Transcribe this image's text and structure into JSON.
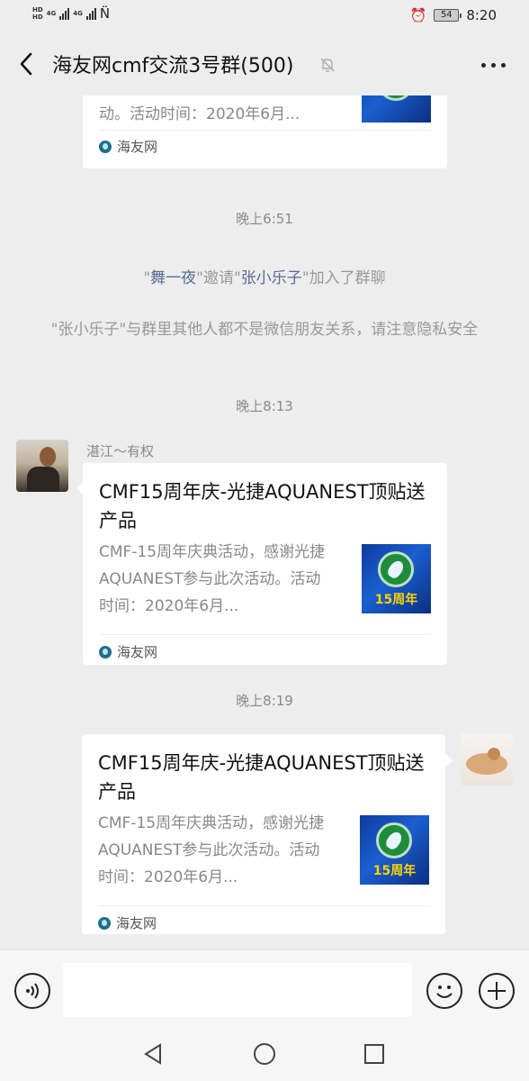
{
  "status_bar": {
    "network_label": "4G",
    "network_label_2": "4G",
    "carrier_speed": "",
    "battery": "54",
    "time": "8:20"
  },
  "header": {
    "title": "海友网cmf交流3号群(500)",
    "icons": [
      "back-icon",
      "mute-icon",
      "more-icon"
    ]
  },
  "messages": {
    "top_card": {
      "desc_tail": "动。活动时间：2020年6月...",
      "source": "海友网"
    },
    "time_1": "晚上6:51",
    "invite": {
      "q1": "\"",
      "inviter": "舞一夜",
      "q2": "\"邀请\"",
      "invitee": "张小乐子",
      "q3": "\"加入了群聊"
    },
    "privacy_notice": "\"张小乐子\"与群里其他人都不是微信朋友关系，请注意隐私安全",
    "time_2": "晚上8:13",
    "msg_1": {
      "sender": "湛江～有权",
      "title": "CMF15周年庆-光捷AQUANEST顶贴送产品",
      "desc": "CMF-15周年庆典活动，感谢光捷AQUANEST参与此次活动。活动时间：2020年6月...",
      "thumb_text": "15周年",
      "source": "海友网"
    },
    "time_3": "晚上8:19",
    "msg_2": {
      "title": "CMF15周年庆-光捷AQUANEST顶贴送产品",
      "desc": "CMF-15周年庆典活动，感谢光捷AQUANEST参与此次活动。活动时间：2020年6月...",
      "thumb_text": "15周年",
      "source": "海友网"
    }
  },
  "input_bar": {
    "icons": [
      "voice-icon",
      "emoji-icon",
      "plus-icon"
    ]
  },
  "system_nav": {
    "icons": [
      "nav-back-icon",
      "nav-home-icon",
      "nav-recent-icon"
    ]
  },
  "colors": {
    "background": "#ededed",
    "link_name": "#576b95",
    "card": "#ffffff"
  }
}
